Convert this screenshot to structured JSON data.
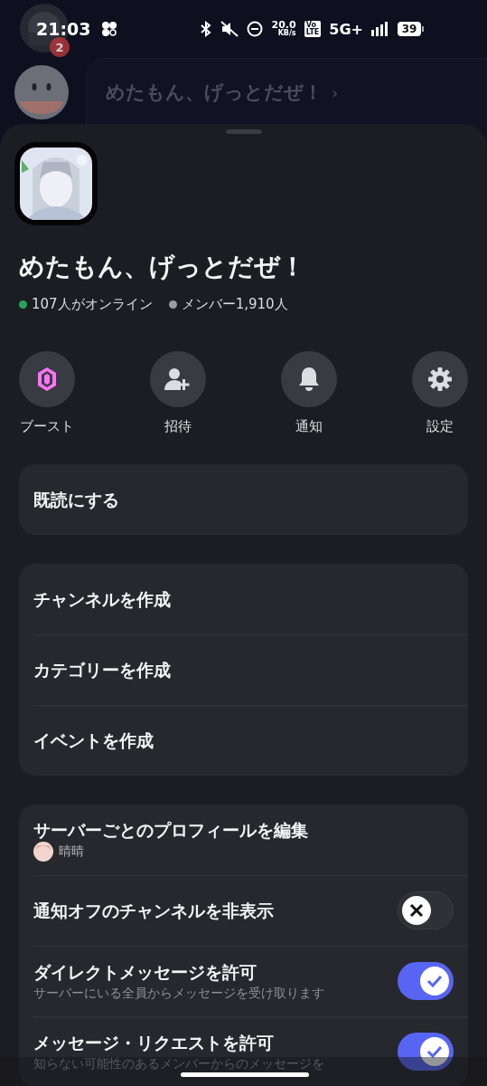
{
  "status_bar": {
    "time": "21:03",
    "net_speed": "20.0",
    "net_unit": "KB/s",
    "volte_top": "Vo",
    "volte_bottom": "LTE",
    "network": "5G+",
    "battery": "39"
  },
  "background": {
    "badge": "2",
    "server_name": "めたもん、げっとだぜ！",
    "chevron": "›"
  },
  "server": {
    "name": "めたもん、げっとだぜ！",
    "stats": [
      {
        "text": "107人がオンライン",
        "color": "#23a55a"
      },
      {
        "text": "メンバー1,910人",
        "color": "#9a9ca6"
      }
    ]
  },
  "actions": [
    {
      "kind": "boost",
      "label": "ブースト"
    },
    {
      "kind": "invite",
      "label": "招待"
    },
    {
      "kind": "bell",
      "label": "通知"
    },
    {
      "kind": "gear",
      "label": "設定"
    }
  ],
  "groups": [
    [
      {
        "kind": "link",
        "title": "既読にする"
      }
    ],
    [
      {
        "kind": "link",
        "title": "チャンネルを作成"
      },
      {
        "kind": "link",
        "title": "カテゴリーを作成"
      },
      {
        "kind": "link",
        "title": "イベントを作成"
      }
    ],
    [
      {
        "kind": "profile",
        "title": "サーバーごとのプロフィールを編集",
        "subtitle": "晴晴"
      },
      {
        "kind": "toggle",
        "title": "通知オフのチャンネルを非表示",
        "on": false
      },
      {
        "kind": "toggle",
        "title": "ダイレクトメッセージを許可",
        "subtitle": "サーバーにいる全員からメッセージを受け取ります",
        "on": true
      },
      {
        "kind": "toggle",
        "title": "メッセージ・リクエストを許可",
        "subtitle": "知らない可能性のあるメンバーからのメッセージを",
        "on": true
      }
    ]
  ]
}
